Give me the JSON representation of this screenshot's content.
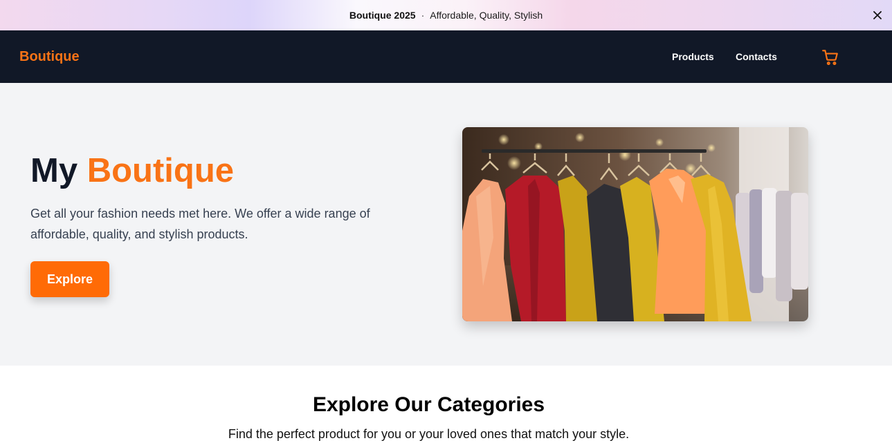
{
  "announcement": {
    "brand": "Boutique 2025",
    "separator": "·",
    "tagline": "Affordable, Quality, Stylish",
    "close_icon": "close-icon"
  },
  "header": {
    "logo": "Boutique",
    "nav": [
      {
        "label": "Products"
      },
      {
        "label": "Contacts"
      }
    ],
    "cart_icon": "shopping-cart-icon"
  },
  "hero": {
    "title_plain": "My",
    "title_accent": "Boutique",
    "description": "Get all your fashion needs met here. We offer a wide range of affordable, quality, and stylish products.",
    "cta_label": "Explore",
    "image_subject": "dresses-on-clothing-rack"
  },
  "categories": {
    "title": "Explore Our Categories",
    "subtitle": "Find the perfect product for you or your loved ones that match your style."
  },
  "colors": {
    "accent": "#f97316",
    "header_bg": "#111827",
    "hero_bg": "#f3f4f6",
    "button_bg": "#ff6b06"
  }
}
